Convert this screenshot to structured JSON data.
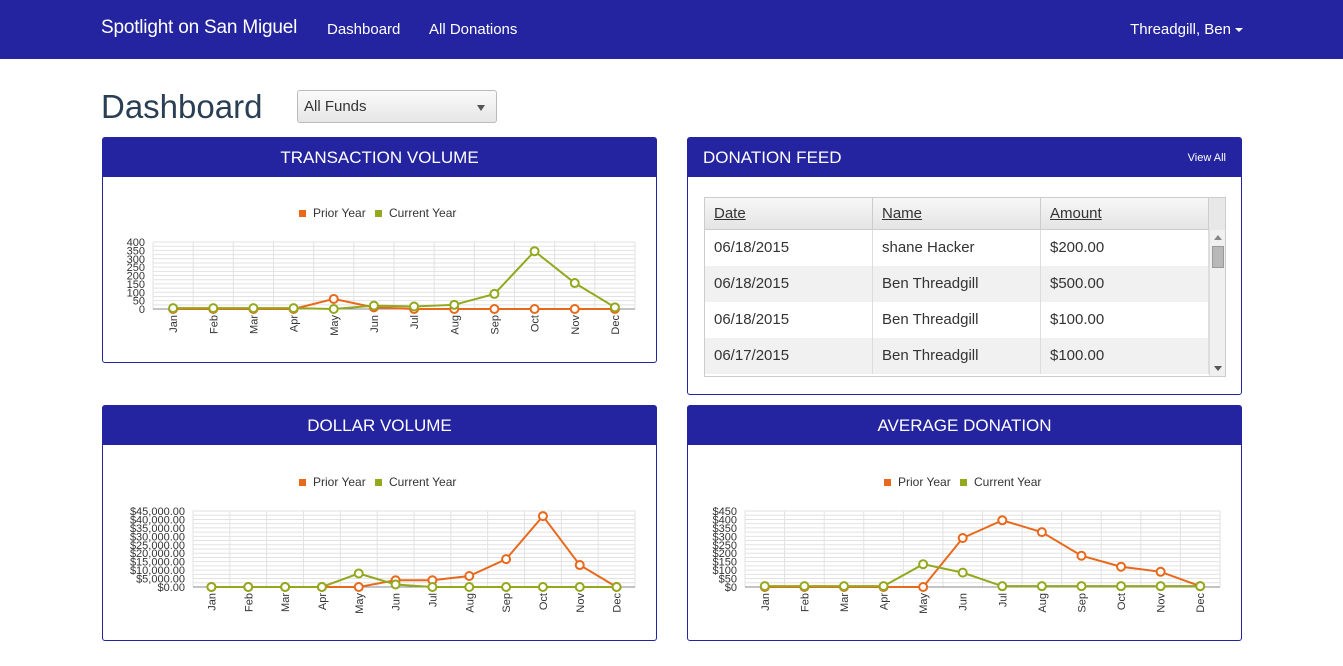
{
  "nav": {
    "brand": "Spotlight on San Miguel",
    "links": [
      "Dashboard",
      "All Donations"
    ],
    "user": "Threadgill, Ben"
  },
  "page": {
    "title": "Dashboard",
    "fund_select": "All Funds"
  },
  "colors": {
    "header": "#2424a0",
    "prior": "#e8691b",
    "current": "#93a81d"
  },
  "panels": {
    "transaction_volume": "TRANSACTION VOLUME",
    "donation_feed": "DONATION FEED",
    "dollar_volume": "DOLLAR VOLUME",
    "average_donation": "AVERAGE DONATION",
    "view_all": "View All"
  },
  "feed": {
    "columns": [
      "Date",
      "Name",
      "Amount"
    ],
    "rows": [
      {
        "date": "06/18/2015",
        "name": "shane Hacker",
        "amount": "$200.00"
      },
      {
        "date": "06/18/2015",
        "name": "Ben Threadgill",
        "amount": "$500.00"
      },
      {
        "date": "06/18/2015",
        "name": "Ben Threadgill",
        "amount": "$100.00"
      },
      {
        "date": "06/17/2015",
        "name": "Ben Threadgill",
        "amount": "$100.00"
      }
    ]
  },
  "chart_data": [
    {
      "type": "line",
      "legend_placement": "top-center",
      "grid": true,
      "categories": [
        "Jan",
        "Feb",
        "Mar",
        "Apr",
        "May",
        "Jun",
        "Jul",
        "Aug",
        "Sep",
        "Oct",
        "Nov",
        "Dec"
      ],
      "yticks": [
        "0",
        "50",
        "100",
        "150",
        "200",
        "250",
        "300",
        "350",
        "400"
      ],
      "ylim": [
        0,
        400
      ],
      "series": [
        {
          "name": "Prior Year",
          "values": [
            0,
            0,
            0,
            0,
            60,
            10,
            0,
            0,
            0,
            0,
            0,
            0
          ]
        },
        {
          "name": "Current Year",
          "values": [
            5,
            5,
            5,
            5,
            0,
            20,
            15,
            25,
            90,
            345,
            155,
            10
          ]
        }
      ]
    },
    {
      "type": "line",
      "legend_placement": "top-center",
      "grid": true,
      "categories": [
        "Jan",
        "Feb",
        "Mar",
        "Apr",
        "May",
        "Jun",
        "Jul",
        "Aug",
        "Sep",
        "Oct",
        "Nov",
        "Dec"
      ],
      "yticks": [
        "$0.00",
        "$5,000.00",
        "$10,000.00",
        "$15,000.00",
        "$20,000.00",
        "$25,000.00",
        "$30,000.00",
        "$35,000.00",
        "$40,000.00",
        "$45,000.00"
      ],
      "ylim": [
        0,
        45000
      ],
      "series": [
        {
          "name": "Prior Year",
          "values": [
            0,
            0,
            0,
            0,
            0,
            4000,
            4000,
            6500,
            16500,
            42000,
            13000,
            0
          ]
        },
        {
          "name": "Current Year",
          "values": [
            0,
            0,
            0,
            0,
            8000,
            1500,
            0,
            0,
            0,
            0,
            0,
            0
          ]
        }
      ]
    },
    {
      "type": "line",
      "legend_placement": "top-center",
      "grid": true,
      "categories": [
        "Jan",
        "Feb",
        "Mar",
        "Apr",
        "May",
        "Jun",
        "Jul",
        "Aug",
        "Sep",
        "Oct",
        "Nov",
        "Dec"
      ],
      "yticks": [
        "$0",
        "$50",
        "$100",
        "$150",
        "$200",
        "$250",
        "$300",
        "$350",
        "$400",
        "$450"
      ],
      "ylim": [
        0,
        450
      ],
      "series": [
        {
          "name": "Prior Year",
          "values": [
            0,
            0,
            0,
            0,
            0,
            290,
            395,
            325,
            185,
            120,
            90,
            5
          ]
        },
        {
          "name": "Current Year",
          "values": [
            5,
            5,
            5,
            5,
            135,
            85,
            5,
            5,
            5,
            5,
            5,
            5
          ]
        }
      ]
    }
  ]
}
